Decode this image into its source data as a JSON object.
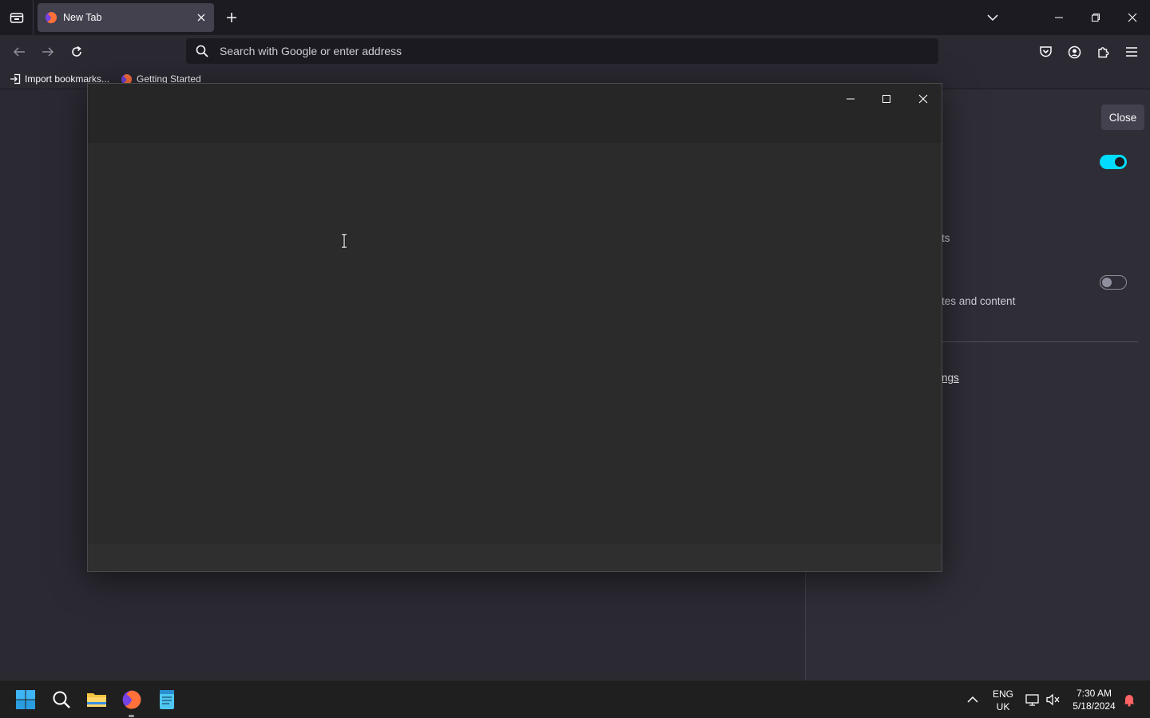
{
  "browser": {
    "tab": {
      "title": "New Tab"
    },
    "urlbar": {
      "placeholder": "Search with Google or enter address"
    },
    "bookmarks": [
      {
        "label": "Import bookmarks..."
      },
      {
        "label": "Getting Started"
      }
    ]
  },
  "panel": {
    "close_label": "Close",
    "fragment_1": "ts",
    "fragment_2": "tes and content",
    "fragment_3": "ngs",
    "toggle_1_on": true,
    "toggle_2_on": false,
    "accent": "#00ddff"
  },
  "taskbar": {
    "language": {
      "line1": "ENG",
      "line2": "UK"
    },
    "clock": {
      "time": "7:30 AM",
      "date": "5/18/2024"
    }
  }
}
